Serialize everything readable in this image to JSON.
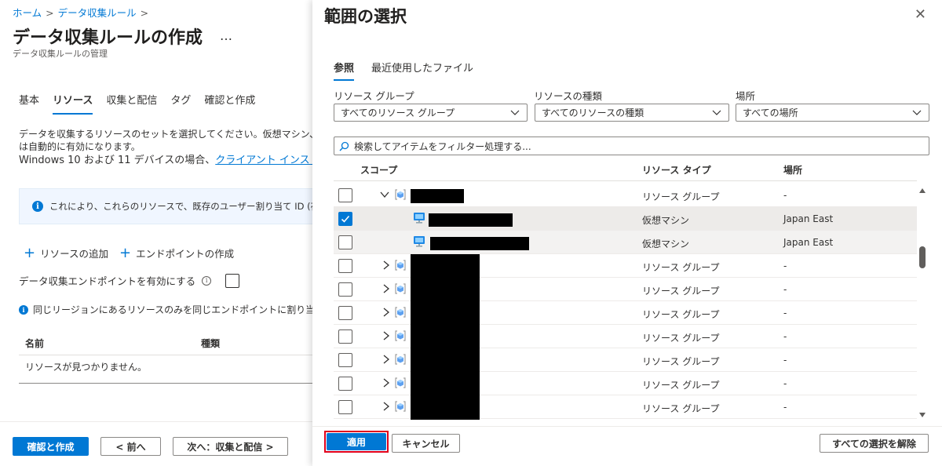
{
  "breadcrumb": {
    "home": "ホーム",
    "dcr": "データ収集ルール",
    "sep": ">"
  },
  "page": {
    "title": "データ収集ルールの作成",
    "more": "…",
    "subtitle": "データ収集ルールの管理"
  },
  "tabs": [
    "基本",
    "リソース",
    "収集と配信",
    "タグ",
    "確認と作成"
  ],
  "description": {
    "line1": "データを収集するリソースのセットを選択してください。仮想マシン、スケール",
    "line2": "は自動的に有効になります。",
    "line3": "Windows 10 および 11 デバイスの場合、",
    "link": "クライアント インストーラーの"
  },
  "info_banner": {
    "icon": "info-icon",
    "text": "これにより、これらのリソースで、既存のユーザー割り当て ID (存在する場合"
  },
  "actions": {
    "add_resource": "リソースの追加",
    "create_endpoint": "エンドポイントの作成"
  },
  "endpoint_toggle": {
    "label": "データ収集エンドポイントを有効にする",
    "checked": false
  },
  "region_note": "同じリージョンにあるリソースのみを同じエンドポイントに割り当てることが",
  "resource_table": {
    "columns": [
      "名前",
      "種類"
    ],
    "empty": "リソースが見つかりません。"
  },
  "footer": {
    "review_create": "確認と作成",
    "prev": "< 前へ",
    "next": "次へ：収集と配信 >"
  },
  "panel": {
    "title": "範囲の選択",
    "close_icon": "close-icon",
    "tabs": [
      "参照",
      "最近使用したファイル"
    ],
    "filters": {
      "resource_group": {
        "label": "リソース グループ",
        "value": "すべてのリソース グループ"
      },
      "resource_type": {
        "label": "リソースの種類",
        "value": "すべてのリソースの種類"
      },
      "location": {
        "label": "場所",
        "value": "すべての場所"
      }
    },
    "search_placeholder": "検索してアイテムをフィルター処理する...",
    "columns": {
      "scope": "スコープ",
      "type": "リソース タイプ",
      "location": "場所"
    },
    "rows": [
      {
        "kind": "group",
        "expanded": true,
        "checked": false,
        "type": "リソース グループ",
        "location": "-"
      },
      {
        "kind": "vm",
        "checked": true,
        "type": "仮想マシン",
        "location": "Japan East"
      },
      {
        "kind": "vm",
        "checked": false,
        "type": "仮想マシン",
        "location": "Japan East"
      },
      {
        "kind": "group",
        "expanded": false,
        "checked": false,
        "type": "リソース グループ",
        "location": "-"
      },
      {
        "kind": "group",
        "expanded": false,
        "checked": false,
        "type": "リソース グループ",
        "location": "-"
      },
      {
        "kind": "group",
        "expanded": false,
        "checked": false,
        "type": "リソース グループ",
        "location": "-"
      },
      {
        "kind": "group",
        "expanded": false,
        "checked": false,
        "type": "リソース グループ",
        "location": "-"
      },
      {
        "kind": "group",
        "expanded": false,
        "checked": false,
        "type": "リソース グループ",
        "location": "-"
      },
      {
        "kind": "group",
        "expanded": false,
        "checked": false,
        "type": "リソース グループ",
        "location": "-"
      },
      {
        "kind": "group",
        "expanded": false,
        "checked": false,
        "type": "リソース グループ",
        "location": "-"
      }
    ],
    "buttons": {
      "apply": "適用",
      "cancel": "キャンセル",
      "clear_all": "すべての選択を解除"
    }
  },
  "colors": {
    "accent": "#0078d4",
    "highlight_border": "#e0001b",
    "redaction": "#000000"
  }
}
